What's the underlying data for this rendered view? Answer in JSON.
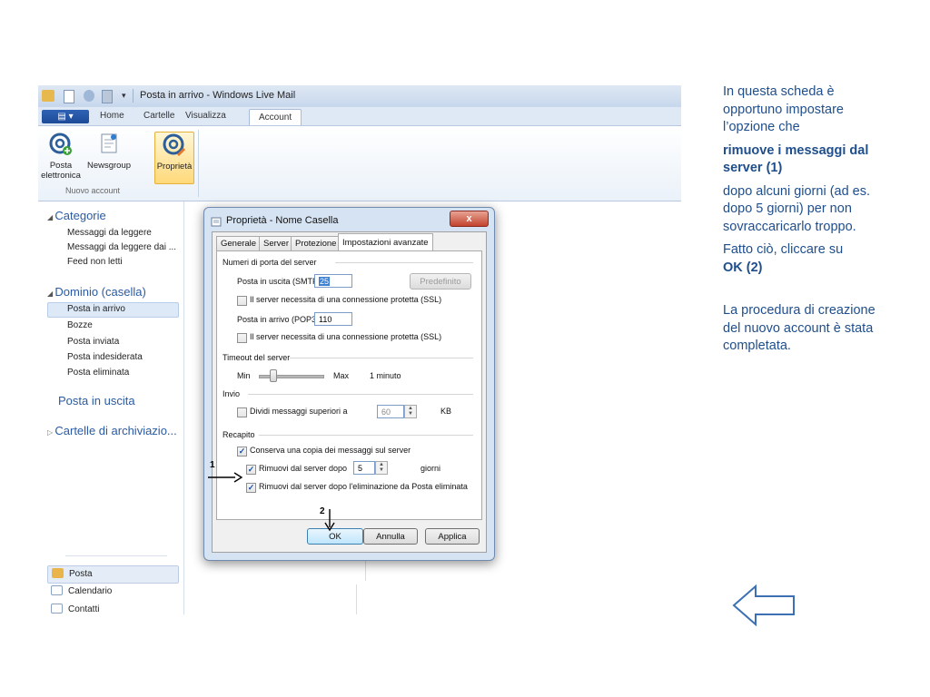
{
  "window": {
    "title": "Posta in arrivo - Windows Live Mail"
  },
  "ribbon": {
    "tabs": [
      "Home",
      "Cartelle",
      "Visualizza",
      "Account"
    ],
    "active_tab": "Account",
    "buttons": [
      {
        "label": "Posta elettronica",
        "icon": "at-add-icon"
      },
      {
        "label": "Newsgroup",
        "icon": "newsgroup-icon"
      },
      {
        "label": "Proprietà",
        "icon": "at-properties-icon"
      }
    ],
    "group_name": "Nuovo account"
  },
  "nav": {
    "categorie": {
      "header": "Categorie",
      "items": [
        "Messaggi da leggere",
        "Messaggi da leggere dai ...",
        "Feed non letti"
      ]
    },
    "dominio": {
      "header": "Dominio (casella)",
      "items": [
        "Posta in arrivo",
        "Bozze",
        "Posta inviata",
        "Posta indesiderata",
        "Posta eliminata"
      ],
      "selected": "Posta in arrivo"
    },
    "posta_uscita": "Posta in uscita",
    "archivio": "Cartelle di archiviazio...",
    "bottom": [
      "Posta",
      "Calendario",
      "Contatti"
    ]
  },
  "dialog": {
    "title": "Proprietà - Nome Casella",
    "close": "x",
    "tabs": [
      "Generale",
      "Server",
      "Protezione",
      "Impostazioni avanzate"
    ],
    "active_tab": "Impostazioni avanzate",
    "ports": {
      "section": "Numeri di porta del server",
      "smtp_label": "Posta in uscita (SMTP):",
      "smtp_value": "25",
      "default_button": "Predefinito",
      "smtp_ssl": "Il server necessita di una connessione protetta (SSL)",
      "pop3_label": "Posta in arrivo (POP3):",
      "pop3_value": "110",
      "pop3_ssl": "Il server necessita di una connessione protetta (SSL)"
    },
    "timeout": {
      "section": "Timeout del server",
      "min": "Min",
      "max": "Max",
      "value": "1 minuto"
    },
    "send": {
      "section": "Invio",
      "split_label": "Dividi messaggi superiori a",
      "split_value": "60",
      "unit": "KB"
    },
    "delivery": {
      "section": "Recapito",
      "keep_copy": "Conserva una copia dei messaggi sul server",
      "remove_after": "Rimuovi dal server dopo",
      "days_value": "5",
      "days_unit": "giorni",
      "remove_on_delete": "Rimuovi dal server dopo l'eliminazione da Posta eliminata"
    },
    "buttons": {
      "ok": "OK",
      "cancel": "Annulla",
      "apply": "Applica"
    },
    "annotations": {
      "one": "1",
      "two": "2"
    }
  },
  "side": {
    "p1": "In questa scheda è opportuno impostare l’opzione che",
    "p2": "rimuove i messaggi dal server (1)",
    "p3": "dopo alcuni giorni (ad es. dopo 5 giorni) per non sovraccaricarlo troppo.",
    "p4a": "Fatto ciò, cliccare su",
    "p4b": "OK (2)",
    "p5": "La procedura di creazione del nuovo account è stata completata."
  },
  "colors": {
    "side_text": "#1f4e8c",
    "nav_header": "#2a5aa3",
    "ribbon_selected": "#ffd97a",
    "close_button": "#c2432e"
  }
}
